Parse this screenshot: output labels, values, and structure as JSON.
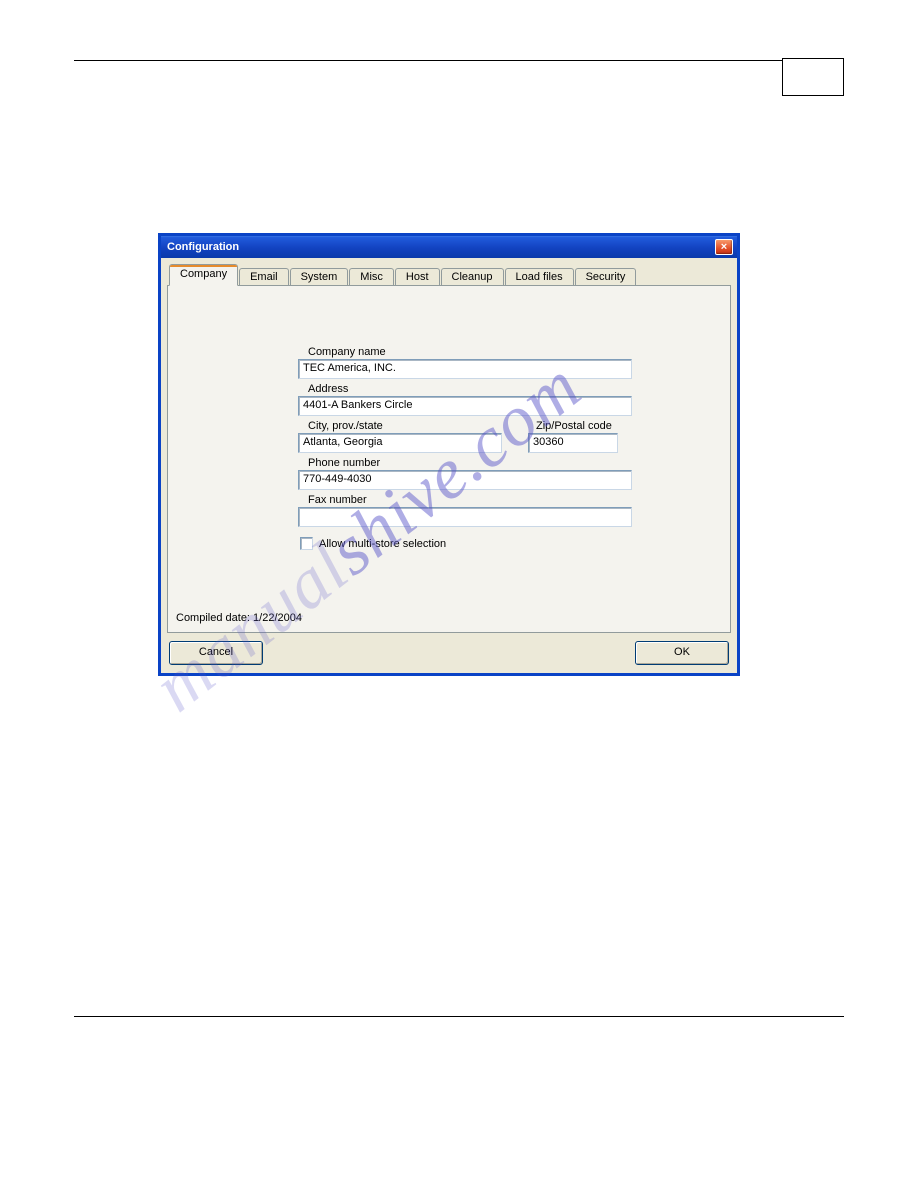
{
  "watermark": {
    "segment1": "manual",
    "segment2": "shive.com"
  },
  "window": {
    "title": "Configuration",
    "close_glyph": "×",
    "tabs": {
      "items": [
        {
          "label": "Company",
          "active": true
        },
        {
          "label": "Email"
        },
        {
          "label": "System"
        },
        {
          "label": "Misc"
        },
        {
          "label": "Host"
        },
        {
          "label": "Cleanup"
        },
        {
          "label": "Load files"
        },
        {
          "label": "Security"
        }
      ]
    },
    "form": {
      "company_name_label": "Company name",
      "company_name_value": "TEC America, INC.",
      "address_label": "Address",
      "address_value": "4401-A Bankers Circle",
      "city_label": "City, prov./state",
      "city_value": "Atlanta, Georgia",
      "zip_label": "Zip/Postal code",
      "zip_value": "30360",
      "phone_label": "Phone number",
      "phone_value": "770-449-4030",
      "fax_label": "Fax number",
      "fax_value": "",
      "checkbox_label": "Allow multi-store selection",
      "checkbox_checked": false
    },
    "compiled_date_text": "Compiled date: 1/22/2004",
    "buttons": {
      "cancel": "Cancel",
      "ok": "OK"
    }
  }
}
